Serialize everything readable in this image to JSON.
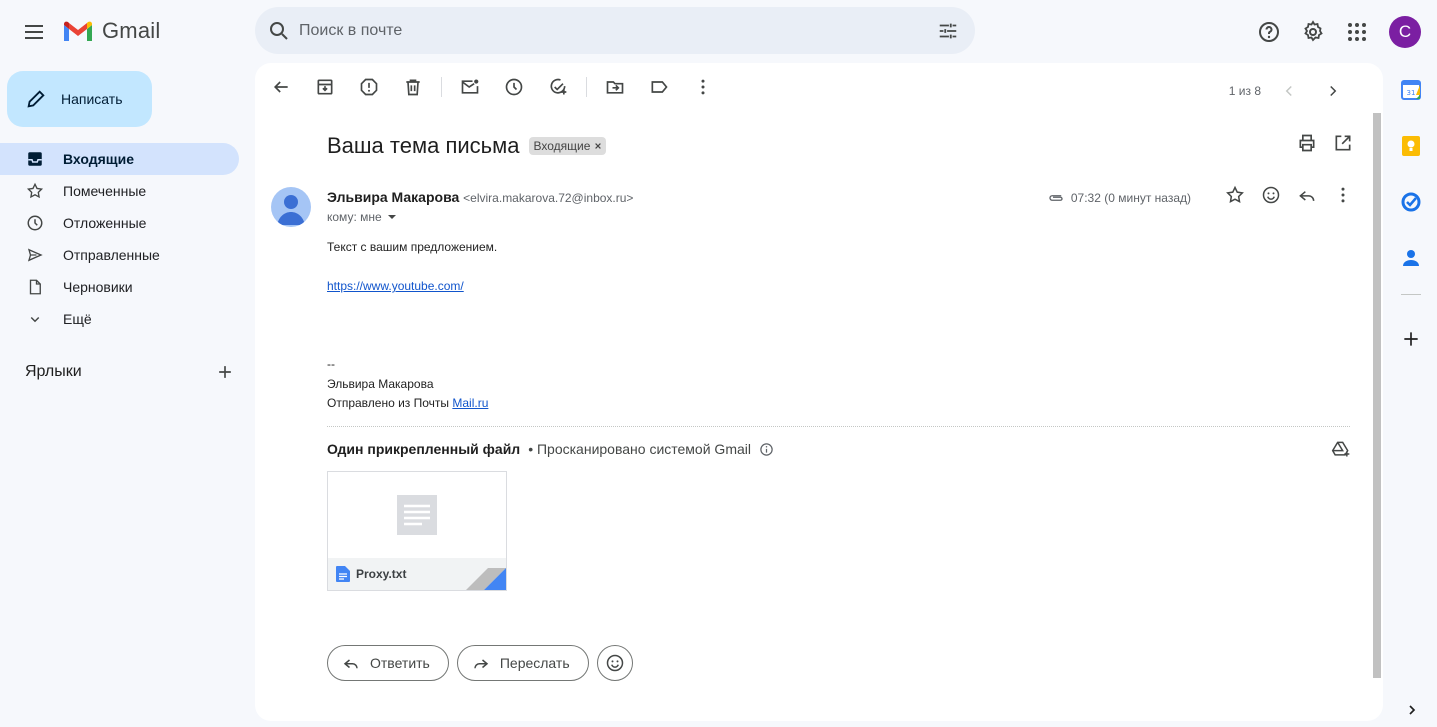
{
  "header": {
    "app_name": "Gmail",
    "search_placeholder": "Поиск в почте",
    "avatar_letter": "С"
  },
  "sidebar": {
    "compose_label": "Написать",
    "items": [
      {
        "label": "Входящие",
        "icon": "inbox-icon"
      },
      {
        "label": "Помеченные",
        "icon": "star-icon"
      },
      {
        "label": "Отложенные",
        "icon": "clock-icon"
      },
      {
        "label": "Отправленные",
        "icon": "send-icon"
      },
      {
        "label": "Черновики",
        "icon": "draft-icon"
      },
      {
        "label": "Ещё",
        "icon": "chevron-down-icon"
      }
    ],
    "labels_title": "Ярлыки"
  },
  "toolbar": {
    "pager_text": "1 из 8"
  },
  "email": {
    "subject": "Ваша тема письма",
    "label_chip": "Входящие",
    "sender_name": "Эльвира Макарова",
    "sender_email": "<elvira.makarova.72@inbox.ru>",
    "to_line": "кому: мне",
    "time": "07:32 (0 минут назад)",
    "body_line1": "Текст с вашим предложением.",
    "link": "https://www.youtube.com/",
    "sig_dash": "--",
    "sig_name": "Эльвира Макарова",
    "sig_sent_prefix": "Отправлено из Почты ",
    "sig_link": "Mail.ru"
  },
  "attachments": {
    "title": "Один прикрепленный файл",
    "scan_text": "• Просканировано системой Gmail",
    "file_name": "Proxy.txt"
  },
  "actions": {
    "reply": "Ответить",
    "forward": "Переслать"
  },
  "colors": {
    "compose_bg": "#c2e7ff",
    "active_nav_bg": "#d3e3fd",
    "avatar_bg": "#7b1fa2",
    "link": "#1155cc"
  }
}
